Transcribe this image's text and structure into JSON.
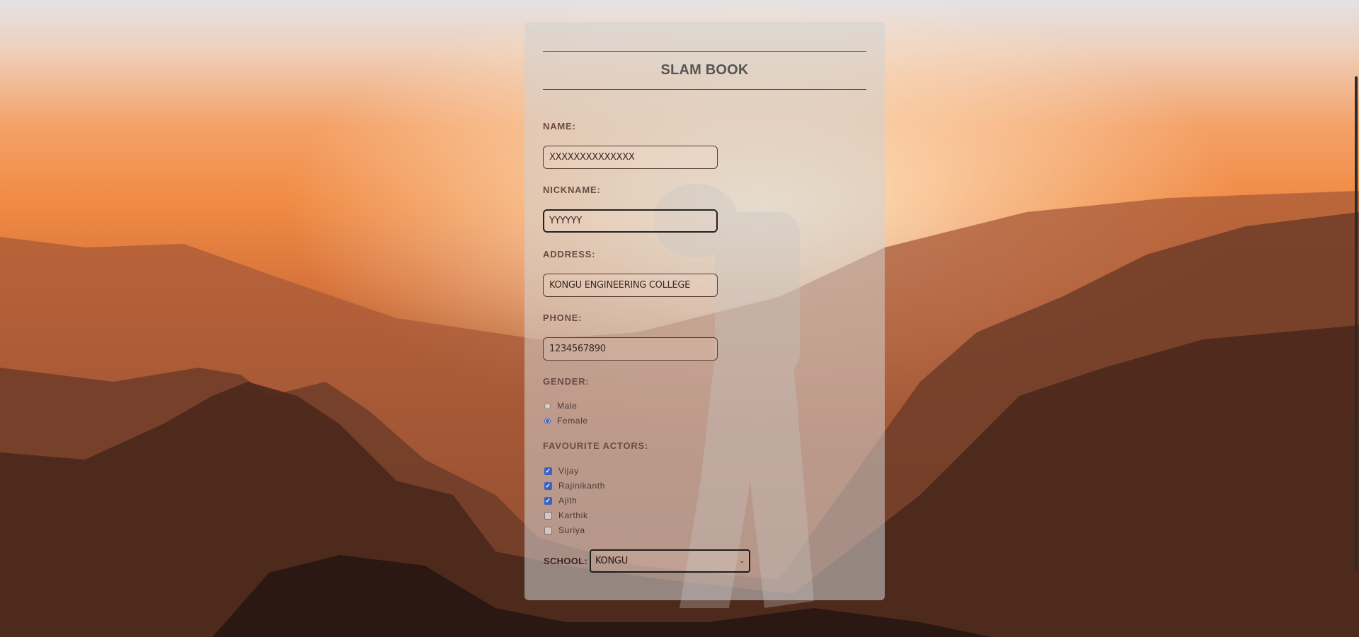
{
  "form": {
    "title": "SLAM BOOK",
    "name": {
      "label": "NAME:",
      "value": "XXXXXXXXXXXXXX"
    },
    "nickname": {
      "label": "NICKNAME:",
      "value": "YYYYYY"
    },
    "address": {
      "label": "ADDRESS:",
      "value": "KONGU ENGINEERING COLLEGE"
    },
    "phone": {
      "label": "PHONE:",
      "value": "1234567890"
    },
    "gender": {
      "label": "GENDER:",
      "options": [
        {
          "label": "Male",
          "checked": false
        },
        {
          "label": "Female",
          "checked": true
        }
      ]
    },
    "actors": {
      "label": "FAVOURITE ACTORS:",
      "options": [
        {
          "label": "Vijay",
          "checked": true
        },
        {
          "label": "Rajinikanth",
          "checked": true
        },
        {
          "label": "Ajith",
          "checked": true
        },
        {
          "label": "Karthik",
          "checked": false
        },
        {
          "label": "Suriya",
          "checked": false
        }
      ]
    },
    "school": {
      "label": "SCHOOL:",
      "selected": "KONGU"
    }
  },
  "colors": {
    "accent": "#3b63c4",
    "card_bg": "rgba(210,210,210,0.55)"
  }
}
